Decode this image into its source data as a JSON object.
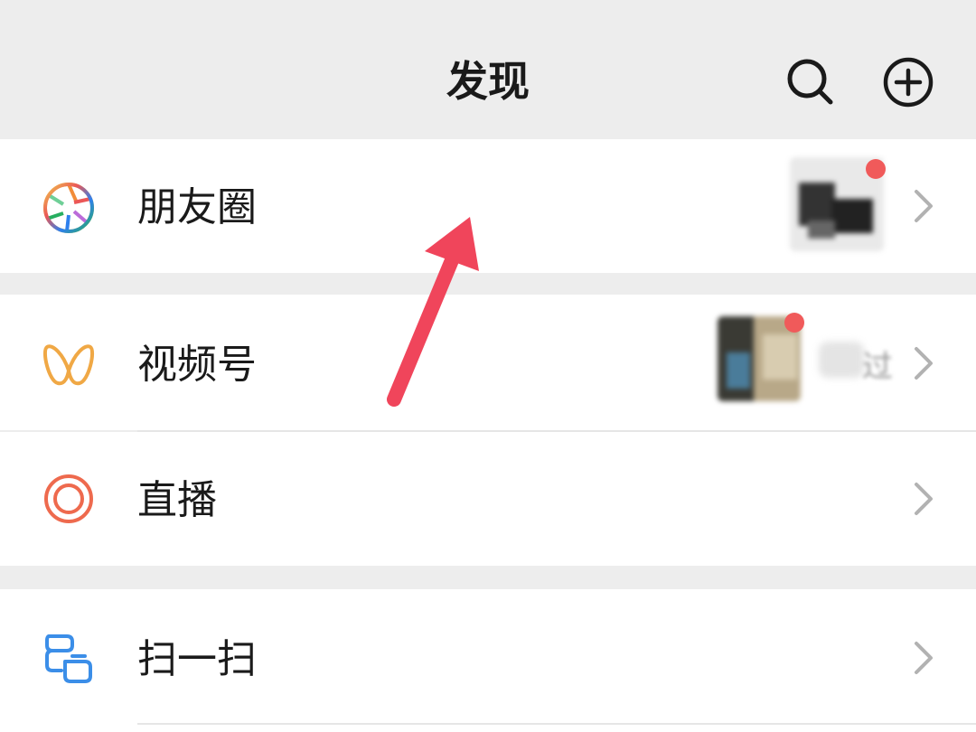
{
  "header": {
    "title": "发现",
    "search_icon": "search-icon",
    "add_icon": "plus-circle-icon"
  },
  "menu": [
    {
      "label": "朋友圈",
      "icon": "moments-aperture-icon",
      "has_thumbnail": true,
      "has_red_dot": true
    },
    {
      "label": "视频号",
      "icon": "channels-butterfly-icon",
      "has_thumbnail": true,
      "has_red_dot": true,
      "trailing_text": "过"
    },
    {
      "label": "直播",
      "icon": "live-circle-icon"
    },
    {
      "label": "扫一扫",
      "icon": "scan-icon"
    }
  ],
  "annotation": {
    "type": "arrow",
    "color": "#f0455b"
  },
  "colors": {
    "background": "#ededed",
    "row_background": "#ffffff",
    "red_dot": "#f05a5a",
    "channels_icon": "#f0a845",
    "live_icon": "#ee6a4e",
    "scan_icon": "#3b8ee8"
  }
}
